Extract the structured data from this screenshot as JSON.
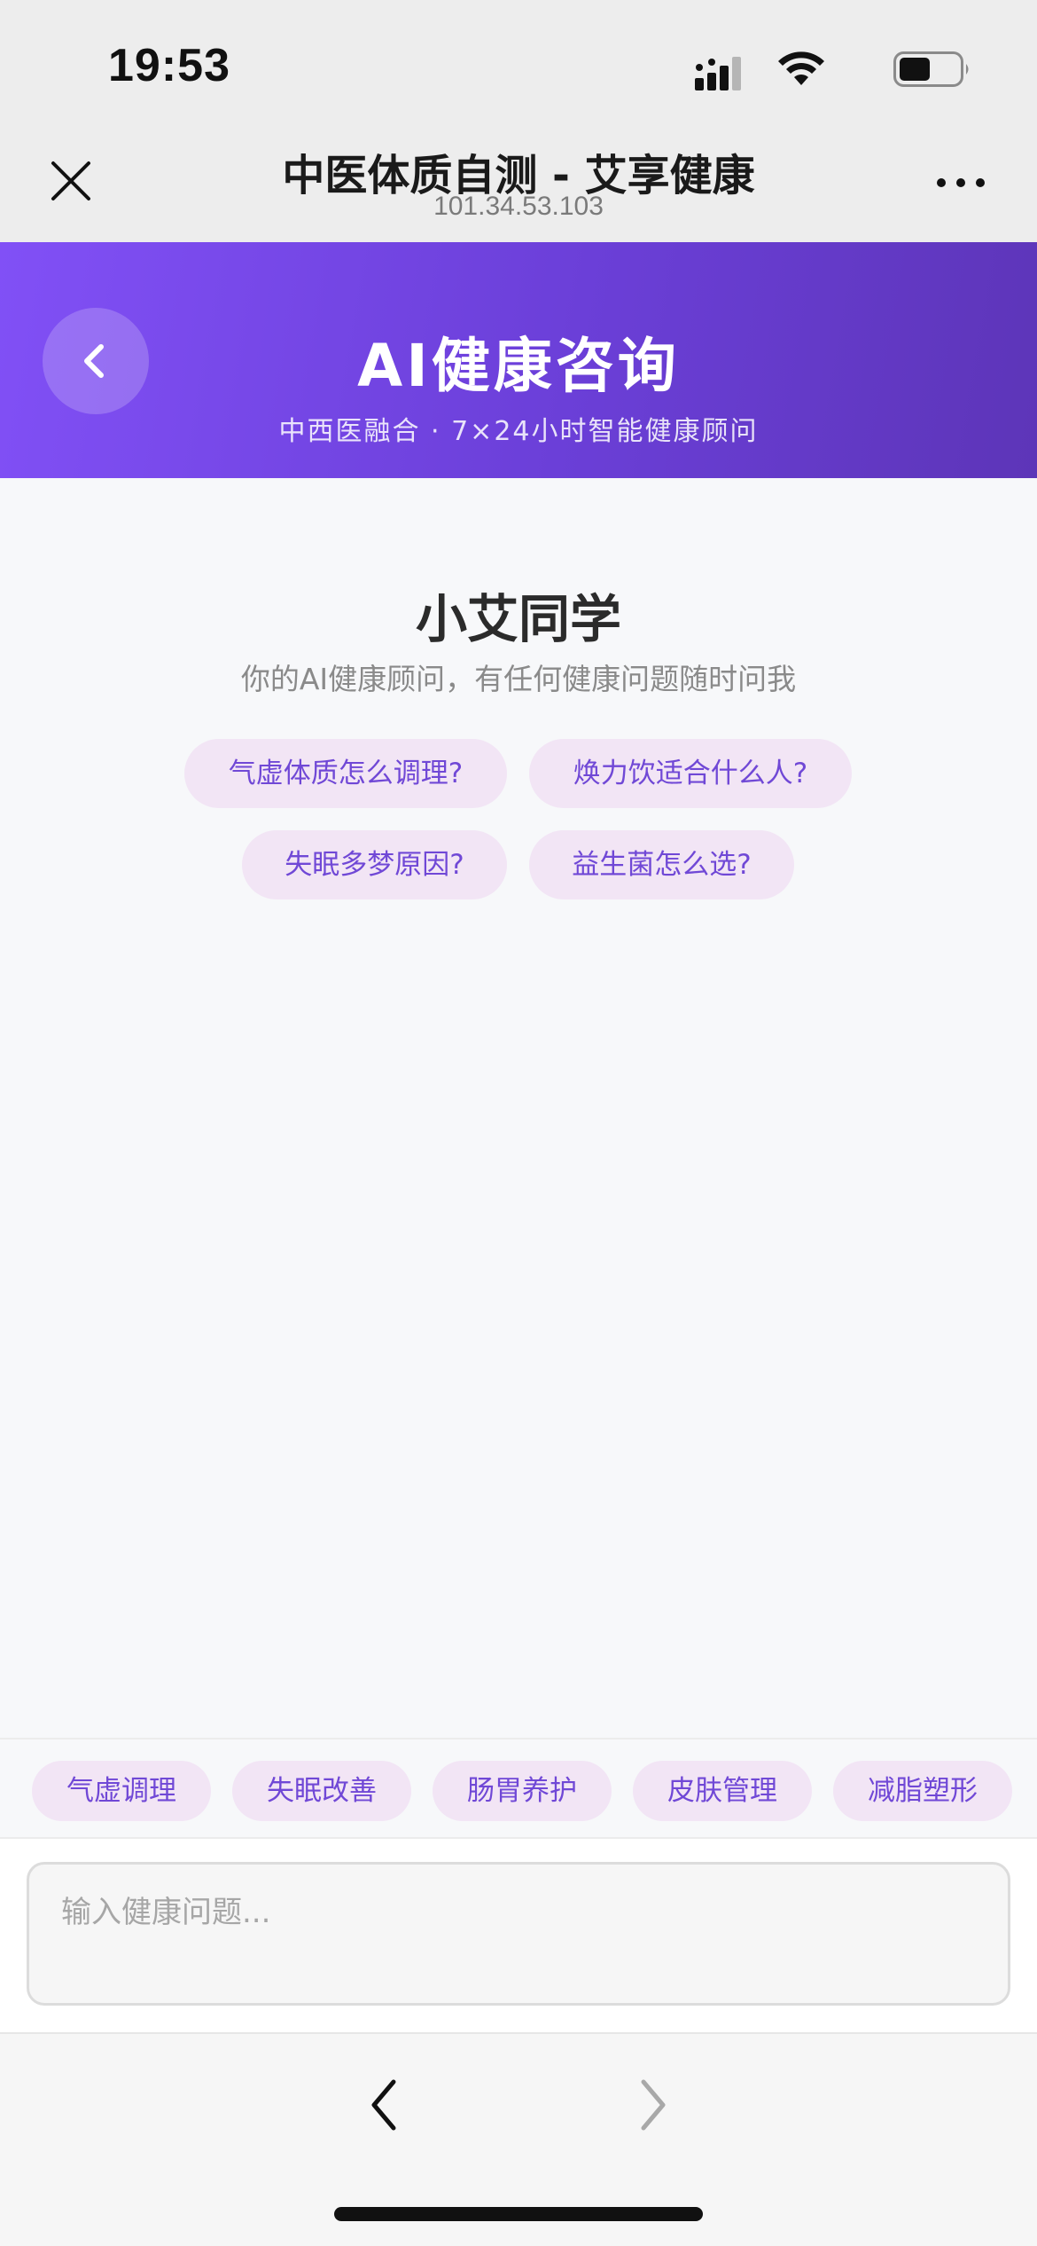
{
  "status_bar": {
    "time": "19:53"
  },
  "browser": {
    "title": "中医体质自测 - 艾享健康",
    "url": "101.34.53.103"
  },
  "header": {
    "title": "AI健康咨询",
    "subtitle": "中西医融合 · 7×24小时智能健康顾问"
  },
  "assistant": {
    "name": "小艾同学",
    "description": "你的AI健康顾问，有任何健康问题随时问我"
  },
  "suggestions": [
    "气虚体质怎么调理?",
    "焕力饮适合什么人?",
    "失眠多梦原因?",
    "益生菌怎么选?"
  ],
  "quick_tags": [
    "气虚调理",
    "失眠改善",
    "肠胃养护",
    "皮肤管理",
    "减脂塑形"
  ],
  "input": {
    "placeholder": "输入健康问题...",
    "value": ""
  },
  "colors": {
    "accent": "#7048d6",
    "chip_bg": "#f2e5f5",
    "header_gradient_start": "#8150f6",
    "header_gradient_end": "#5d35b8"
  }
}
